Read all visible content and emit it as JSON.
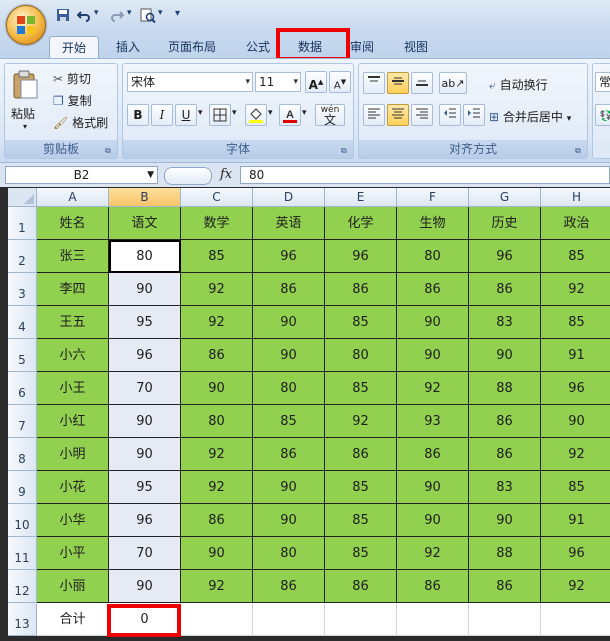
{
  "quick_access": {
    "save_icon": "save-icon",
    "undo_icon": "undo-icon",
    "redo_icon": "redo-icon",
    "preview_icon": "print-preview-icon",
    "customize": "▾"
  },
  "tabs": [
    {
      "label": "开始",
      "active": true
    },
    {
      "label": "插入"
    },
    {
      "label": "页面布局"
    },
    {
      "label": "公式"
    },
    {
      "label": "数据",
      "highlighted": true
    },
    {
      "label": "审阅"
    },
    {
      "label": "视图"
    }
  ],
  "ribbon": {
    "clipboard": {
      "label": "剪贴板",
      "paste": "粘贴",
      "cut": "剪切",
      "copy": "复制",
      "format_painter": "格式刷"
    },
    "font": {
      "label": "字体",
      "font_name": "宋体",
      "font_size": "11",
      "bold": "B",
      "italic": "I",
      "underline": "U",
      "grow": "A",
      "shrink": "A",
      "wen": "wén"
    },
    "alignment": {
      "label": "对齐方式",
      "wrap_text": "自动换行",
      "merge_center": "合并后居中"
    },
    "number": {
      "partial": "常"
    }
  },
  "formula_bar": {
    "name_box": "B2",
    "fx": "fx",
    "value": "80"
  },
  "sheet": {
    "columns": [
      "A",
      "B",
      "C",
      "D",
      "E",
      "F",
      "G",
      "H"
    ],
    "selected_column": "B",
    "rows": [
      {
        "n": "1",
        "cells": [
          "姓名",
          "语文",
          "数学",
          "英语",
          "化学",
          "生物",
          "历史",
          "政治"
        ]
      },
      {
        "n": "2",
        "cells": [
          "张三",
          "80",
          "85",
          "96",
          "96",
          "80",
          "96",
          "85"
        ]
      },
      {
        "n": "3",
        "cells": [
          "李四",
          "90",
          "92",
          "86",
          "86",
          "86",
          "86",
          "92"
        ]
      },
      {
        "n": "4",
        "cells": [
          "王五",
          "95",
          "92",
          "90",
          "85",
          "90",
          "83",
          "85"
        ]
      },
      {
        "n": "5",
        "cells": [
          "小六",
          "96",
          "86",
          "90",
          "80",
          "90",
          "90",
          "91"
        ]
      },
      {
        "n": "6",
        "cells": [
          "小王",
          "70",
          "90",
          "80",
          "85",
          "92",
          "88",
          "96"
        ]
      },
      {
        "n": "7",
        "cells": [
          "小红",
          "90",
          "80",
          "85",
          "92",
          "93",
          "86",
          "90"
        ]
      },
      {
        "n": "8",
        "cells": [
          "小明",
          "90",
          "92",
          "86",
          "86",
          "86",
          "86",
          "92"
        ]
      },
      {
        "n": "9",
        "cells": [
          "小花",
          "95",
          "92",
          "90",
          "85",
          "90",
          "83",
          "85"
        ]
      },
      {
        "n": "10",
        "cells": [
          "小华",
          "96",
          "86",
          "90",
          "85",
          "90",
          "90",
          "91"
        ]
      },
      {
        "n": "11",
        "cells": [
          "小平",
          "70",
          "90",
          "80",
          "85",
          "92",
          "88",
          "96"
        ]
      },
      {
        "n": "12",
        "cells": [
          "小丽",
          "90",
          "92",
          "86",
          "86",
          "86",
          "86",
          "92"
        ]
      },
      {
        "n": "13",
        "cells": [
          "合计",
          "0",
          "",
          "",
          "",
          "",
          "",
          ""
        ]
      }
    ]
  },
  "colors": {
    "green_fill": "#92d050",
    "highlight_red": "#ee0000",
    "selection": "#e6eaf5"
  }
}
